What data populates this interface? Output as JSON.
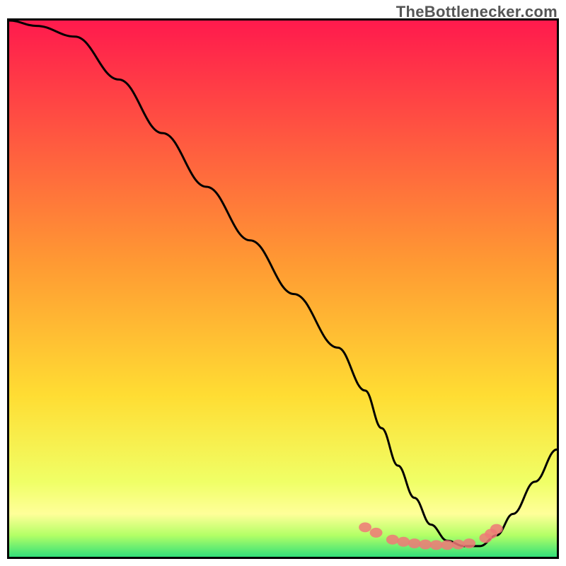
{
  "watermark": {
    "text": "TheBottlenecker.com"
  },
  "chart_data": {
    "type": "line",
    "title": "",
    "xlabel": "",
    "ylabel": "",
    "xlim": [
      0,
      100
    ],
    "ylim": [
      0,
      100
    ],
    "grid": false,
    "legend": false,
    "background_gradient": [
      {
        "pos": 0.0,
        "color": "#ff1a4d"
      },
      {
        "pos": 0.45,
        "color": "#ff9933"
      },
      {
        "pos": 0.7,
        "color": "#ffdd33"
      },
      {
        "pos": 0.86,
        "color": "#f0ff66"
      },
      {
        "pos": 0.92,
        "color": "#ffff99"
      },
      {
        "pos": 0.96,
        "color": "#b3ff66"
      },
      {
        "pos": 1.0,
        "color": "#33e07a"
      }
    ],
    "series": [
      {
        "name": "bottleneck-curve",
        "x": [
          0,
          5,
          12,
          20,
          28,
          36,
          44,
          52,
          60,
          65,
          68,
          71,
          74,
          77,
          80,
          83,
          86,
          89,
          92,
          96,
          100
        ],
        "y": [
          100,
          99,
          97,
          89,
          79,
          69,
          59,
          49,
          39,
          31,
          24,
          17,
          11,
          6,
          3,
          2,
          2,
          4,
          8,
          14,
          20
        ]
      }
    ],
    "markers": {
      "name": "sample-markers",
      "shape": "ellipse",
      "color": "#f07878",
      "points": [
        {
          "x": 65,
          "y": 5.5
        },
        {
          "x": 67,
          "y": 4.5
        },
        {
          "x": 70,
          "y": 3.2
        },
        {
          "x": 72,
          "y": 2.8
        },
        {
          "x": 74,
          "y": 2.5
        },
        {
          "x": 76,
          "y": 2.3
        },
        {
          "x": 78,
          "y": 2.2
        },
        {
          "x": 80,
          "y": 2.2
        },
        {
          "x": 82,
          "y": 2.3
        },
        {
          "x": 84,
          "y": 2.5
        },
        {
          "x": 87,
          "y": 3.5
        },
        {
          "x": 88,
          "y": 4.3
        },
        {
          "x": 89,
          "y": 5.2
        }
      ]
    }
  }
}
